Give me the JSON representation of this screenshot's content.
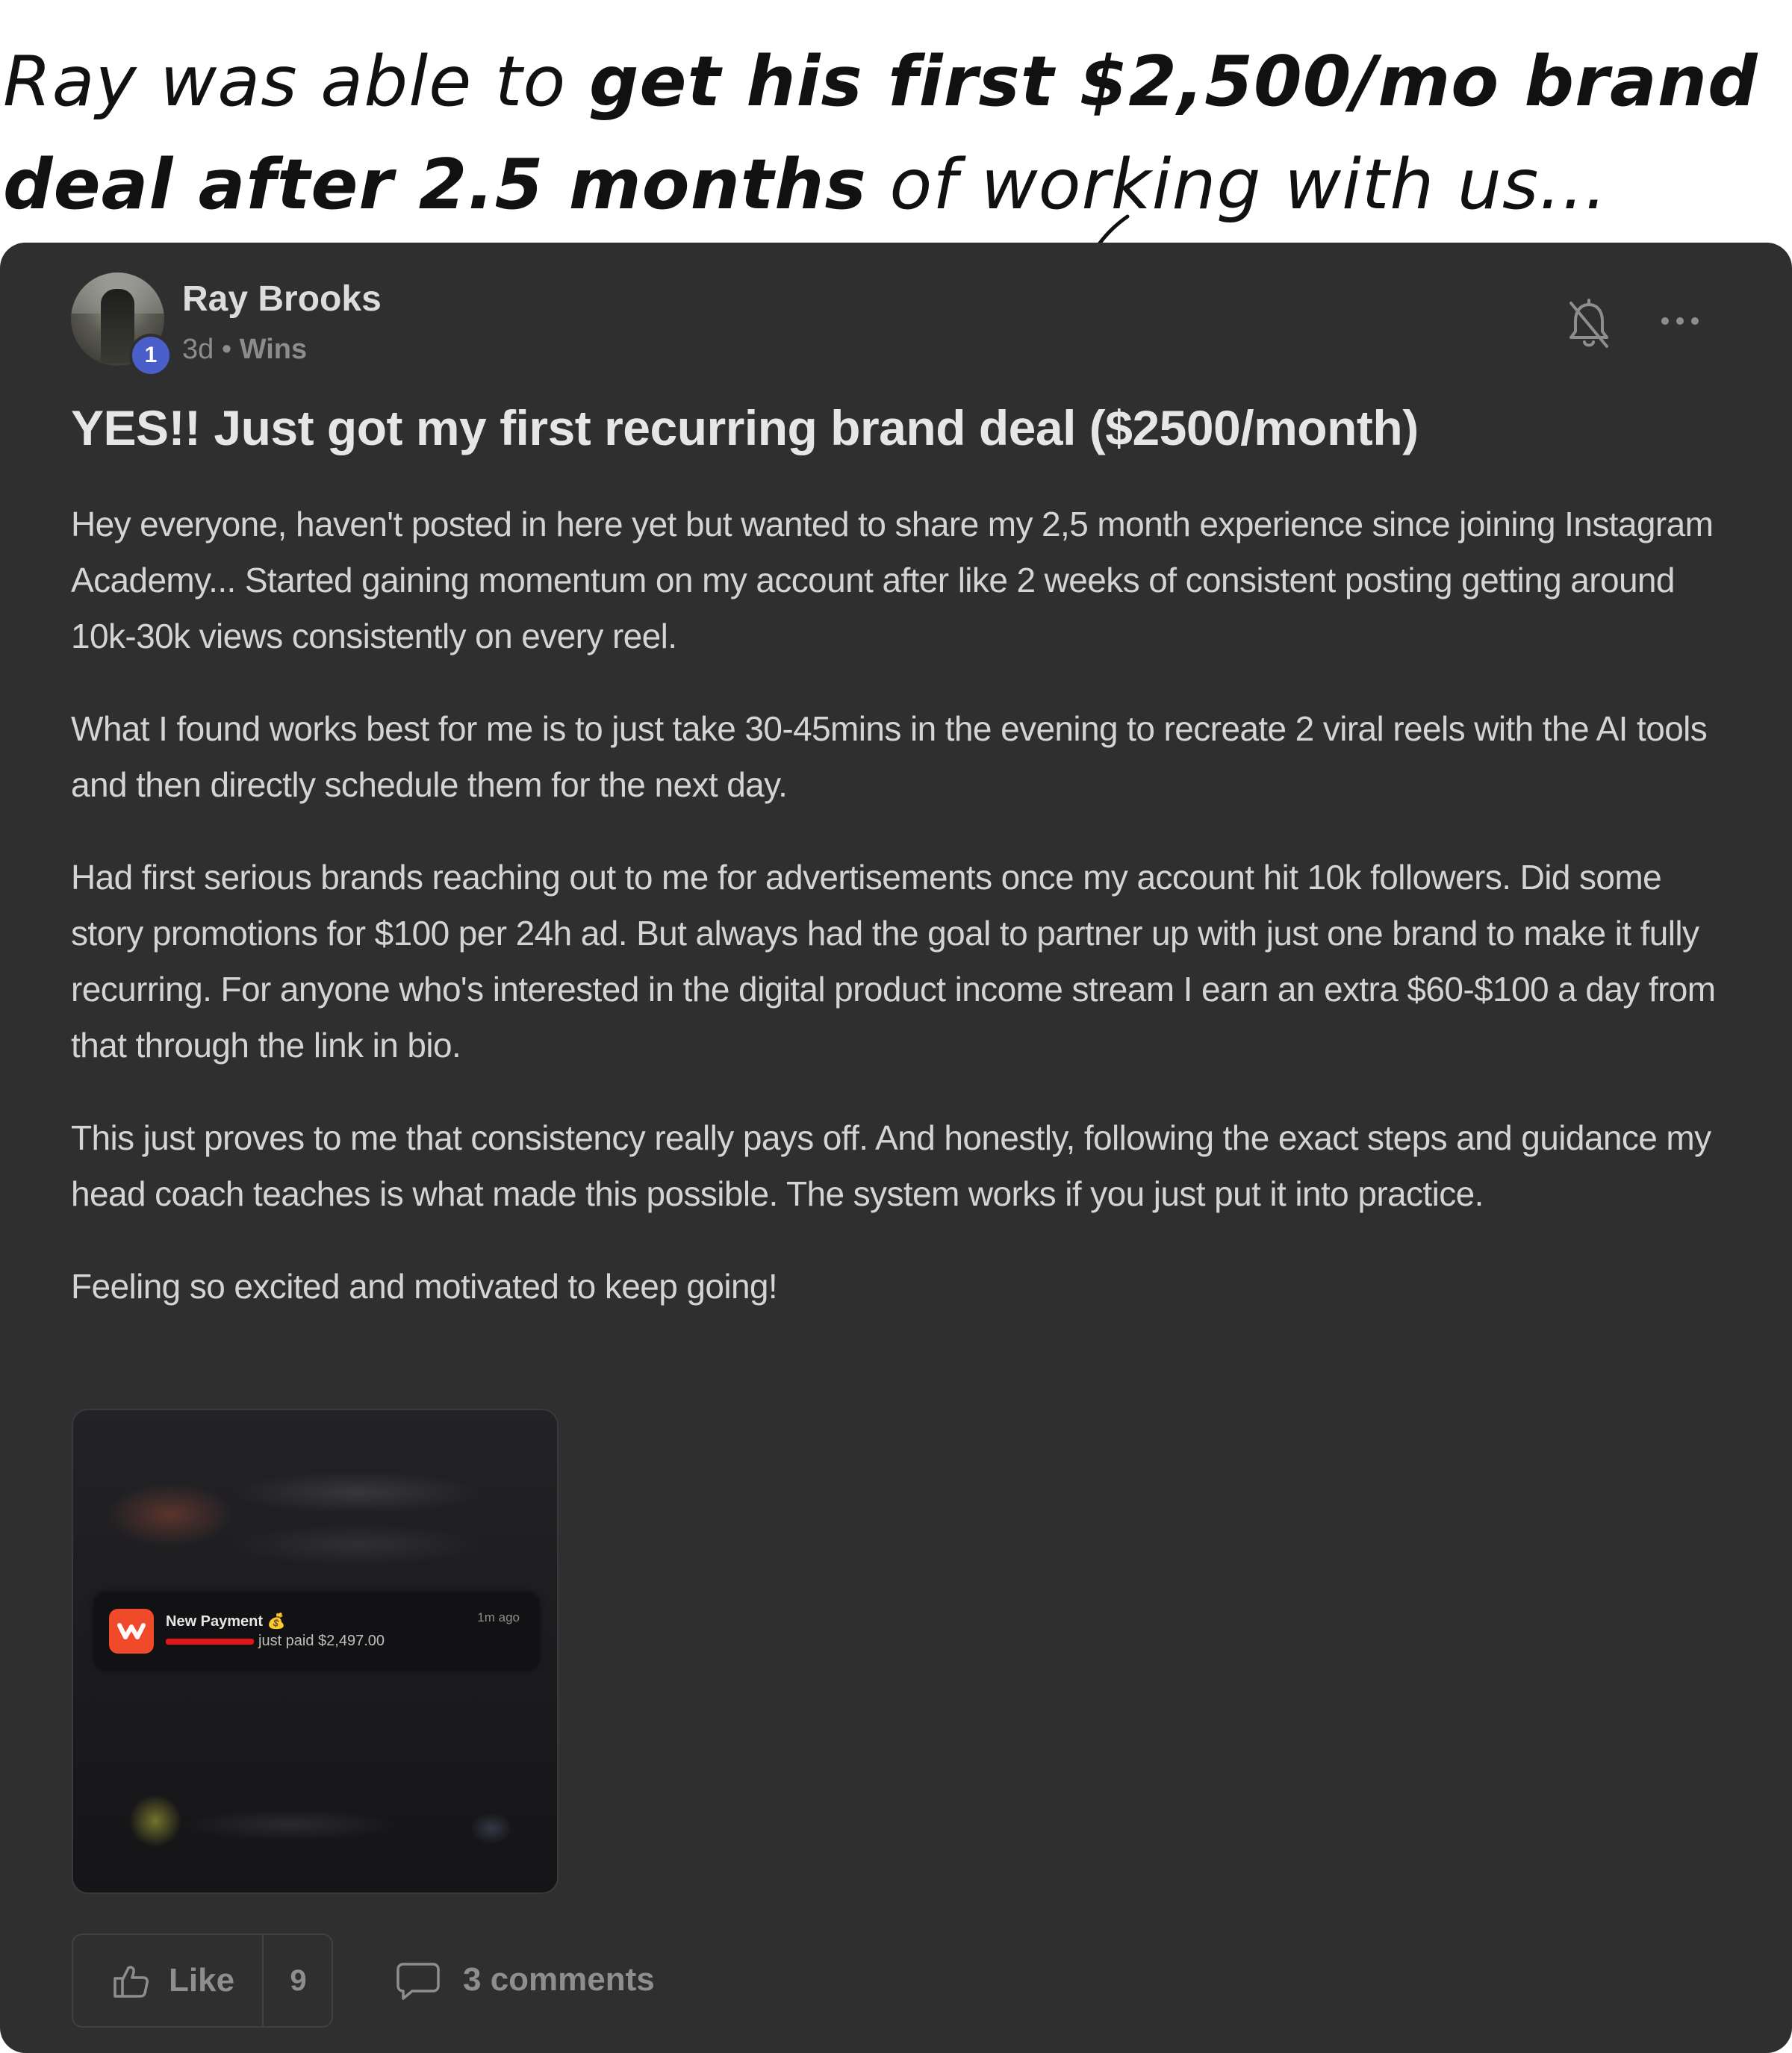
{
  "headline": {
    "line1_light": "Ray was able to ",
    "line1_bold": "get his first $2,500/mo brand",
    "line2_bold": "deal after 2.5 months",
    "line2_light": " of working with us..."
  },
  "post": {
    "author": "Ray Brooks",
    "level": "1",
    "time": "3d",
    "separator": " • ",
    "category": "Wins",
    "title": "YES!! Just got my first recurring brand deal ($2500/month)",
    "paragraphs": [
      "Hey everyone, haven't posted in here yet but wanted to share my 2,5 month experience since joining Instagram Academy... Started gaining momentum on my account after like 2 weeks of consistent posting getting around 10k-30k views consistently on every reel.",
      "What I found works best for me is to just take 30-45mins in the evening to recreate 2 viral reels with the AI tools and then directly schedule them for the next day.",
      "Had first serious brands reaching out to me for advertisements once my account hit 10k followers. Did some story promotions for $100 per 24h ad. But always had the goal to partner up with just one brand to make it fully recurring. For anyone who's interested in the digital product income stream I earn an extra $60-$100 a day from that through the link in bio.",
      "This just proves to me that consistency really pays off. And honestly, following the exact steps and guidance my head coach teaches is what made this possible. The system works if you just put it into practice.",
      "Feeling so excited and motivated to keep going!"
    ],
    "attachment": {
      "notification_title": "New Payment 💰",
      "notification_text": "just paid $2,497.00",
      "notification_time": "1m ago"
    },
    "actions": {
      "like_label": "Like",
      "like_count": "9",
      "comments_label": "3 comments"
    }
  },
  "colors": {
    "card_bg": "#2f2f30",
    "level_badge": "#4a5fc9",
    "notification_icon": "#f04a2a",
    "redaction": "#e3141a"
  },
  "icons": [
    "arrow-annotation-icon",
    "bell-off-icon",
    "more-dots-icon",
    "thumbs-up-icon",
    "comment-icon",
    "payment-app-icon"
  ]
}
